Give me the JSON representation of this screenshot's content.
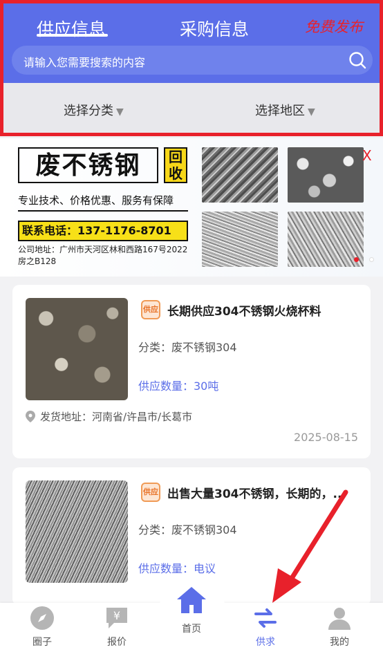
{
  "header": {
    "tabs": [
      {
        "label": "供应信息",
        "active": true
      },
      {
        "label": "采购信息",
        "active": false
      }
    ],
    "publish_label": "免费发布",
    "search_placeholder": "请输入您需要搜索的内容",
    "filters": [
      {
        "label": "选择分类"
      },
      {
        "label": "选择地区"
      }
    ],
    "caret": "▼"
  },
  "banner": {
    "title": "废不锈钢",
    "tag": "回收",
    "slogan": "专业技术、价格优惠、服务有保障",
    "phone": "联系电话：137-1176-8701",
    "address": "公司地址：广州市天河区林和西路167号2022房之B128",
    "close": "X"
  },
  "listings": [
    {
      "badge": "供应",
      "title": "长期供应304不锈钢火烧杯料",
      "category": "分类：废不锈钢304",
      "quantity": "供应数量：30吨",
      "location": "发货地址：河南省/许昌市/长葛市",
      "date": "2025-08-15"
    },
    {
      "badge": "供应",
      "title": "出售大量304不锈钢，长期的，...",
      "category": "分类：废不锈钢304",
      "quantity": "供应数量：电议"
    }
  ],
  "nav": {
    "items": [
      {
        "label": "圈子",
        "icon": "compass-icon"
      },
      {
        "label": "报价",
        "icon": "price-chat-icon"
      },
      {
        "label": "首页",
        "icon": "home-icon"
      },
      {
        "label": "供求",
        "icon": "exchange-icon",
        "active": true
      },
      {
        "label": "我的",
        "icon": "user-icon"
      }
    ]
  },
  "colors": {
    "primary": "#5b6ee8",
    "highlight": "#e8212b",
    "badge": "#f09a55"
  }
}
